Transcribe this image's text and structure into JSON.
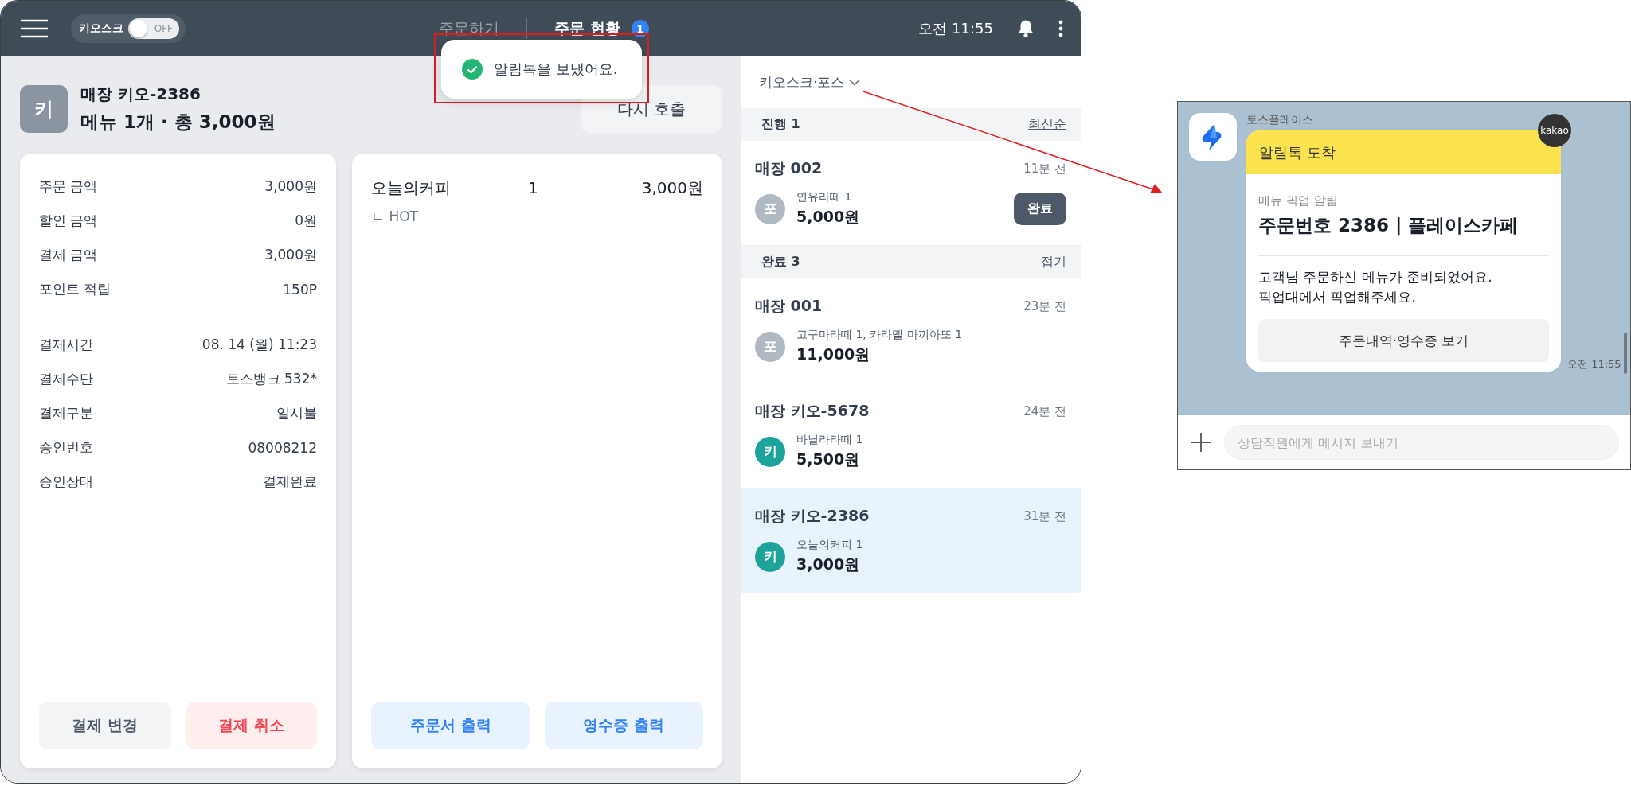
{
  "top_bar": {
    "kiosk_label": "키오스크",
    "kiosk_toggle": {
      "label": "OFF",
      "on": false
    },
    "tabs": [
      {
        "label": "주문하기",
        "selected": false
      },
      {
        "label": "주문 현황",
        "selected": true,
        "badge": "1"
      }
    ],
    "time": "오전 11:55"
  },
  "toast": {
    "message": "알림톡을 보냈어요."
  },
  "order": {
    "avatar": "키",
    "store": "매장 키오-2386",
    "summary": "메뉴 1개 · 총 3,000원",
    "recall_button": "다시 호출"
  },
  "payment_card": {
    "groups": [
      [
        {
          "label": "주문 금액",
          "value": "3,000원"
        },
        {
          "label": "할인 금액",
          "value": "0원"
        },
        {
          "label": "결제 금액",
          "value": "3,000원"
        },
        {
          "label": "포인트 적립",
          "value": "150P"
        }
      ],
      [
        {
          "label": "결제시간",
          "value": "08. 14 (월) 11:23"
        },
        {
          "label": "결제수단",
          "value": "토스뱅크 532*"
        },
        {
          "label": "결제구분",
          "value": "일시불"
        },
        {
          "label": "승인번호",
          "value": "08008212"
        },
        {
          "label": "승인상태",
          "value": "결제완료"
        }
      ]
    ],
    "buttons": [
      {
        "label": "결제 변경",
        "kind": "neutral"
      },
      {
        "label": "결제 취소",
        "kind": "danger"
      }
    ]
  },
  "items_card": {
    "items": [
      {
        "name": "오늘의커피",
        "qty": "1",
        "price": "3,000원",
        "options": [
          "ㄴ HOT"
        ]
      }
    ],
    "buttons": [
      {
        "label": "주문서 출력",
        "kind": "primary"
      },
      {
        "label": "영수증 출력",
        "kind": "primary"
      }
    ]
  },
  "order_list": {
    "filter": "키오스크·포스",
    "sections": [
      {
        "title": "진행 1",
        "action": "최신순",
        "kind": "sort",
        "orders": [
          {
            "store": "매장 002",
            "time": "11분 전",
            "channel": "포",
            "kind": "pos",
            "items": "연유라떼 1",
            "total": "5,000원",
            "button": "완료",
            "selected": false
          }
        ]
      },
      {
        "title": "완료 3",
        "action": "접기",
        "kind": "toggle",
        "orders": [
          {
            "store": "매장 001",
            "time": "23분 전",
            "channel": "포",
            "kind": "pos",
            "items": "고구마라떼 1, 카라멜 마끼아또 1",
            "total": "11,000원",
            "selected": false
          },
          {
            "store": "매장 키오-5678",
            "time": "24분 전",
            "channel": "키",
            "kind": "kiosk",
            "items": "바닐라라떼 1",
            "total": "5,500원",
            "selected": false
          },
          {
            "store": "매장 키오-2386",
            "time": "31분 전",
            "channel": "키",
            "kind": "kiosk",
            "items": "오늘의커피 1",
            "total": "3,000원",
            "selected": true
          }
        ]
      }
    ]
  },
  "kakao": {
    "sender": "토스플레이스",
    "badge": "kakao",
    "header": "알림톡 도착",
    "subtitle": "메뉴 픽업 알림",
    "title": "주문번호 2386 | 플레이스카페",
    "body": "고객님 주문하신 메뉴가 준비되었어요.\n픽업대에서 픽업해주세요.",
    "button": "주문내역·영수증 보기",
    "time": "오전 11:55",
    "input_placeholder": "상담직원에게 메시지 보내기"
  }
}
